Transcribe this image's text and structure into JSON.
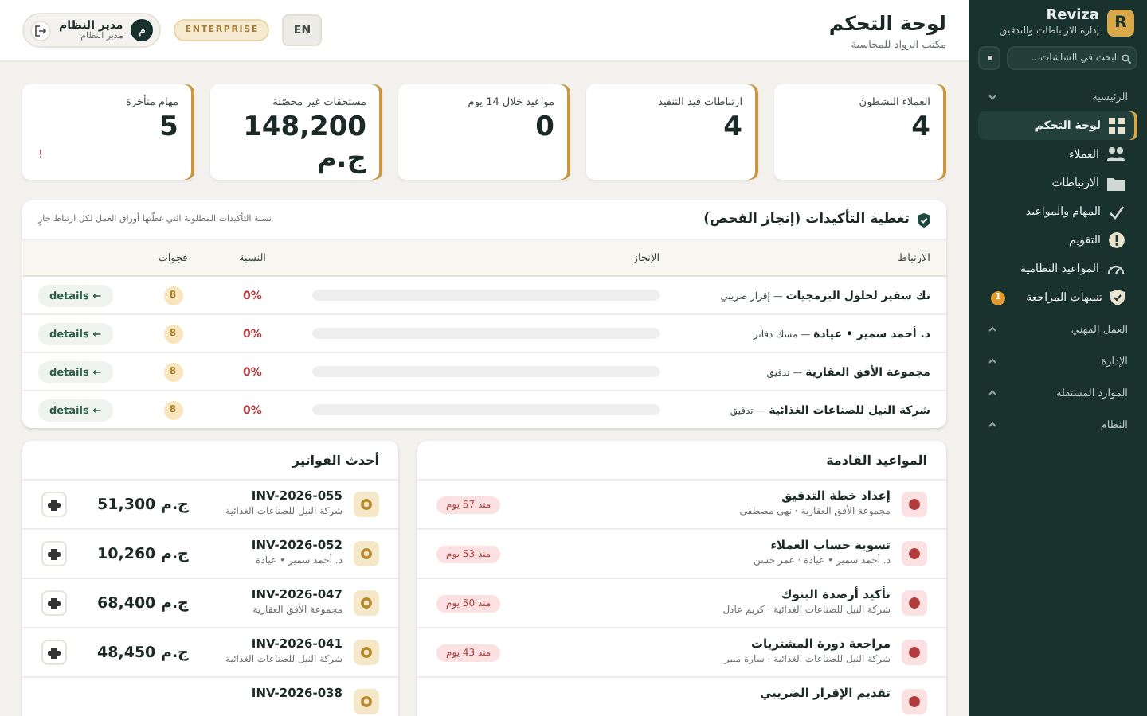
{
  "sidebar": {
    "brand": {
      "logo": "R",
      "name": "Reviza",
      "tagline": "إدارة الارتباطات والتدقيق"
    },
    "search": {
      "placeholder": "ابحث في الشاشات..."
    },
    "sections": [
      {
        "title": "الرئيسية",
        "expanded": true,
        "items": [
          {
            "label": "لوحة التحكم",
            "selected": true
          },
          {
            "label": "العملاء",
            "selected": false
          },
          {
            "label": "الارتباطات",
            "selected": false
          },
          {
            "label": "المهام والمواعيد",
            "selected": false
          },
          {
            "label": "التقويم",
            "selected": false
          },
          {
            "label": "المواعيد النظامية",
            "selected": false
          },
          {
            "label": "تنبيهات المراجعة",
            "selected": false,
            "badge": "1"
          }
        ]
      },
      {
        "title": "العمل المهني",
        "expanded": false
      },
      {
        "title": "الإدارة",
        "expanded": false
      },
      {
        "title": "الموارد المستقلة",
        "expanded": false
      },
      {
        "title": "النظام",
        "expanded": false
      }
    ]
  },
  "header": {
    "title": "لوحة التحكم",
    "subtitle": "مكتب الرواد للمحاسبة",
    "user": {
      "avatar": "م",
      "name": "مدير النظام",
      "role": "مدير النظام"
    },
    "plan": "ENTERPRISE",
    "language": "EN"
  },
  "stats": [
    {
      "label": "العملاء النشطون",
      "value": "4"
    },
    {
      "label": "ارتباطات قيد التنفيذ",
      "value": "4"
    },
    {
      "label": "مواعيد خلال 14 يوم",
      "value": "0"
    },
    {
      "label": "مستحقات غير محصّلة",
      "value": "148,200 ج.م"
    },
    {
      "label": "مهام متأخرة",
      "value": "5",
      "alert": "!"
    }
  ],
  "coverage": {
    "title": "تغطية التأكيدات (إنجاز الفحص)",
    "subtitle": "نسبة التأكيدات المطلوبة التي غطّتها أوراق العمل لكل ارتباط جارٍ",
    "columns": [
      "الارتباط",
      "الإنجاز",
      "النسبة",
      "فجوات"
    ],
    "rows": [
      {
        "engagement": "**تك سفير لحلول البرمجيات** — إقرار ضريبي",
        "level": 0,
        "percent": "0%",
        "gaps": "8",
        "action": "← details"
      },
      {
        "engagement": "**د. أحمد سمير • عيادة** — مسك دفاتر",
        "level": 0,
        "percent": "0%",
        "gaps": "8",
        "action": "← details"
      },
      {
        "engagement": "**مجموعة الأفق العقارية** — تدقيق",
        "level": 0,
        "percent": "0%",
        "gaps": "8",
        "action": "← details"
      },
      {
        "engagement": "**شركة النيل للصناعات الغذائية** — تدقيق",
        "level": 0,
        "percent": "0%",
        "gaps": "8",
        "action": "← details"
      }
    ]
  },
  "deadlines": {
    "title": "المواعيد القادمة",
    "items": [
      {
        "title": "إعداد خطة التدقيق",
        "subtitle": "مجموعة الأفق العقارية · نهى مصطفى",
        "badge": "منذ 57 يوم"
      },
      {
        "title": "تسوية حساب العملاء",
        "subtitle": "د. أحمد سمير • عيادة · عمر حسن",
        "badge": "منذ 53 يوم"
      },
      {
        "title": "تأكيد أرصدة البنوك",
        "subtitle": "شركة النيل للصناعات الغذائية · كريم عادل",
        "badge": "منذ 50 يوم"
      },
      {
        "title": "مراجعة دورة المشتريات",
        "subtitle": "شركة النيل للصناعات الغذائية · سارة منير",
        "badge": "منذ 43 يوم"
      },
      {
        "title": "تقديم الإقرار الضريبي"
      }
    ]
  },
  "invoices": {
    "title": "أحدث الفواتير",
    "items": [
      {
        "number": "INV-2026-055",
        "client": "شركة النيل للصناعات الغذائية",
        "amount": "ج.م 51,300"
      },
      {
        "number": "INV-2026-052",
        "client": "د. أحمد سمير • عيادة",
        "amount": "ج.م 10,260"
      },
      {
        "number": "INV-2026-047",
        "client": "مجموعة الأفق العقارية",
        "amount": "ج.م 68,400"
      },
      {
        "number": "INV-2026-041",
        "client": "شركة النيل للصناعات الغذائية",
        "amount": "ج.م 48,450"
      },
      {
        "number": "INV-2026-038"
      }
    ]
  }
}
